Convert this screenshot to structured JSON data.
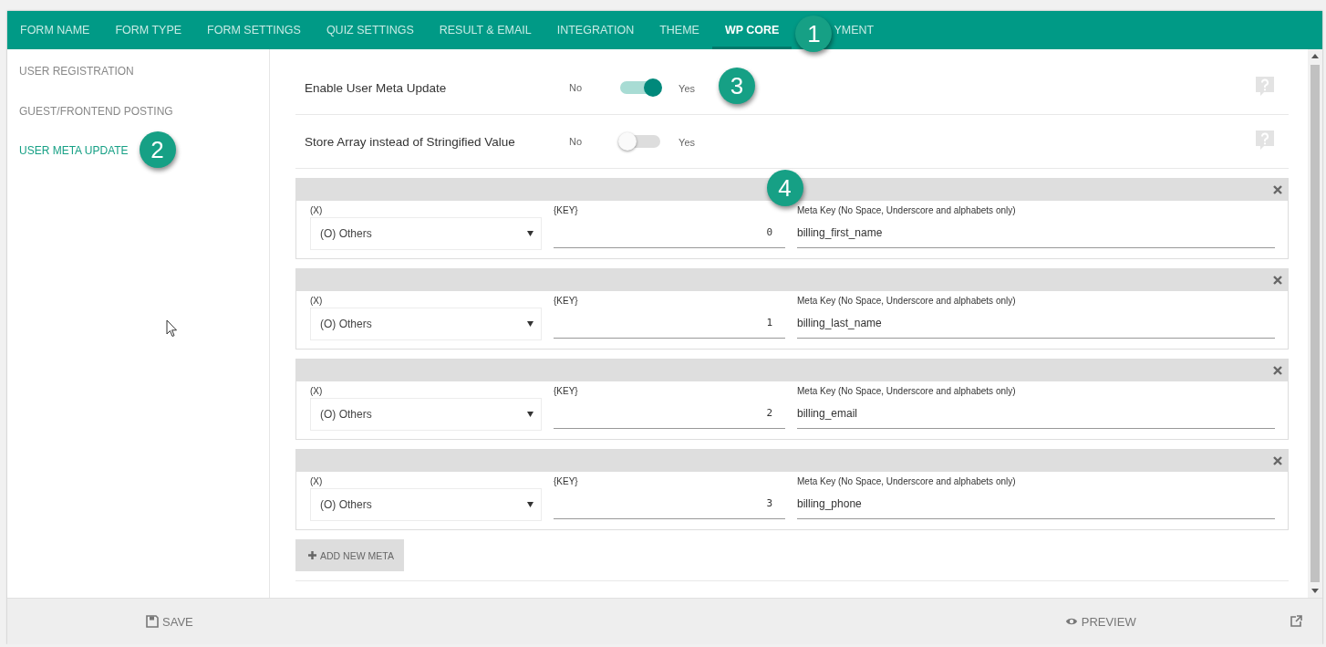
{
  "tabs": [
    {
      "label": "FORM NAME",
      "selected": false
    },
    {
      "label": "FORM TYPE",
      "selected": false
    },
    {
      "label": "FORM SETTINGS",
      "selected": false
    },
    {
      "label": "QUIZ SETTINGS",
      "selected": false
    },
    {
      "label": "RESULT & EMAIL",
      "selected": false
    },
    {
      "label": "INTEGRATION",
      "selected": false
    },
    {
      "label": "THEME",
      "selected": false
    },
    {
      "label": "WP CORE",
      "selected": true,
      "callout": "1"
    },
    {
      "label": "YMENT",
      "selected": false
    }
  ],
  "sidebar": {
    "items": [
      {
        "label": "USER REGISTRATION",
        "selected": false
      },
      {
        "label": "GUEST/FRONTEND POSTING",
        "selected": false
      },
      {
        "label": "USER META UPDATE",
        "selected": true,
        "callout": "2"
      }
    ]
  },
  "settings": [
    {
      "label": "Enable User Meta Update",
      "off_label": "No",
      "on_label": "Yes",
      "on": true,
      "callout": "3"
    },
    {
      "label": "Store Array instead of Stringified Value",
      "off_label": "No",
      "on_label": "Yes",
      "on": false
    }
  ],
  "meta_rows": [
    {
      "select_label": "(X)",
      "select_value": "(O) Others",
      "key_label": "{KEY}",
      "key_value": "0",
      "meta_key_label": "Meta Key (No Space, Underscore and alphabets only)",
      "meta_key_value": "billing_first_name",
      "callout": "4"
    },
    {
      "select_label": "(X)",
      "select_value": "(O) Others",
      "key_label": "{KEY}",
      "key_value": "1",
      "meta_key_label": "Meta Key (No Space, Underscore and alphabets only)",
      "meta_key_value": "billing_last_name"
    },
    {
      "select_label": "(X)",
      "select_value": "(O) Others",
      "key_label": "{KEY}",
      "key_value": "2",
      "meta_key_label": "Meta Key (No Space, Underscore and alphabets only)",
      "meta_key_value": "billing_email"
    },
    {
      "select_label": "(X)",
      "select_value": "(O) Others",
      "key_label": "{KEY}",
      "key_value": "3",
      "meta_key_label": "Meta Key (No Space, Underscore and alphabets only)",
      "meta_key_value": "billing_phone"
    }
  ],
  "add_button": "ADD NEW META",
  "footer": {
    "save": "SAVE",
    "preview": "PREVIEW"
  }
}
